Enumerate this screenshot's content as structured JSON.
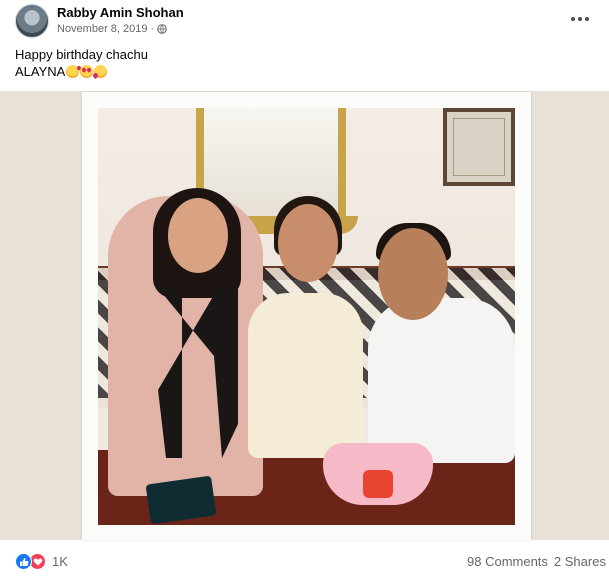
{
  "post": {
    "author": "Rabby Amin Shohan",
    "date": "November 8, 2019",
    "separator": "·",
    "audience_icon": "globe-icon",
    "more_icon": "more-options-icon",
    "caption": {
      "line1": "Happy birthday chachu",
      "line2": "ALAYNA",
      "emojis": [
        "kissing-face-emoji",
        "heart-eyes-emoji",
        "smiling-face-with-hearts-emoji"
      ]
    }
  },
  "photo": {
    "icon": "photo-image"
  },
  "footer": {
    "reaction_icons": [
      "like-icon",
      "love-icon"
    ],
    "reaction_count": "1K",
    "comments": "98 Comments",
    "shares": "2 Shares"
  },
  "colors": {
    "like": "#1877f2",
    "love": "#f33e58",
    "secondary_text": "#65676b"
  }
}
